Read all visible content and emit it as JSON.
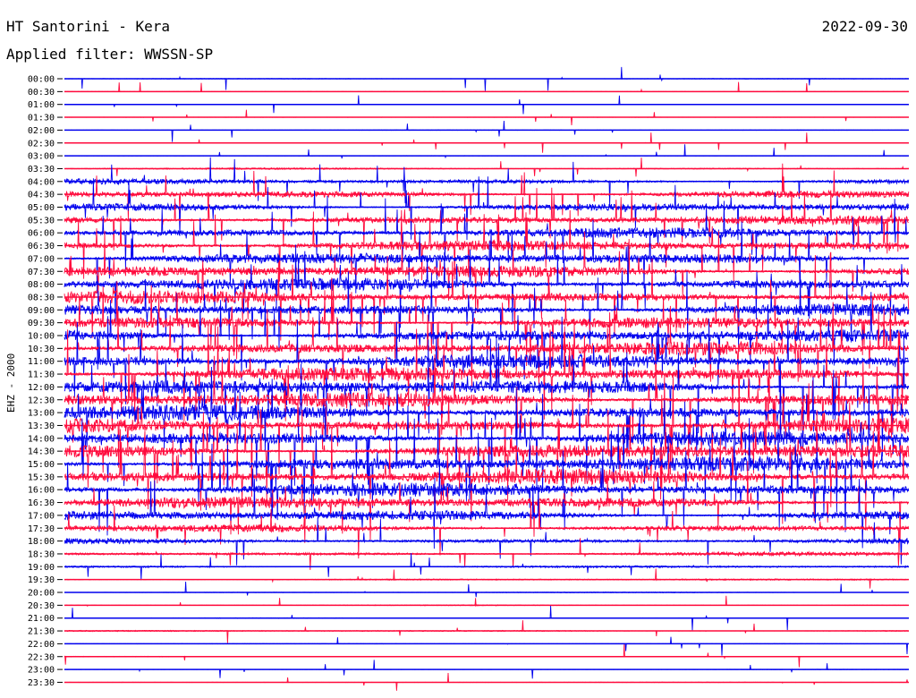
{
  "header": {
    "station": "HT Santorini - Kera",
    "date": "2022-09-30",
    "filter_label": "Applied filter: WWSSN-SP"
  },
  "channel_label": "EHZ - 2000",
  "colors": {
    "trace_a": "#0000ee",
    "trace_b": "#ff0a3c",
    "text": "#000000",
    "background": "#ffffff"
  },
  "chart_data": {
    "type": "line",
    "title": "HT Santorini - Kera",
    "subtitle": "Applied filter: WWSSN-SP",
    "ylabel": "EHZ - 2000",
    "xlabel": "",
    "y_tick_labels": [
      "00:00",
      "00:30",
      "01:00",
      "01:30",
      "02:00",
      "02:30",
      "03:00",
      "03:30",
      "04:00",
      "04:30",
      "05:00",
      "05:30",
      "06:00",
      "06:30",
      "07:00",
      "07:30",
      "08:00",
      "08:30",
      "09:00",
      "09:30",
      "10:00",
      "10:30",
      "11:00",
      "11:30",
      "12:00",
      "12:30",
      "13:00",
      "13:30",
      "14:00",
      "14:30",
      "15:00",
      "15:30",
      "16:00",
      "16:30",
      "17:00",
      "17:30",
      "18:00",
      "18:30",
      "19:00",
      "19:30",
      "20:00",
      "20:30",
      "21:00",
      "21:30",
      "22:00",
      "22:30",
      "23:00",
      "23:30"
    ],
    "row_duration_minutes": 30,
    "series_colors_alternate": [
      "#0000ee",
      "#ff0a3c"
    ],
    "activity_level": [
      0.05,
      0.02,
      0.01,
      0.02,
      0.03,
      0.02,
      0.02,
      0.1,
      0.35,
      0.5,
      0.55,
      0.6,
      0.65,
      0.7,
      0.75,
      0.8,
      0.85,
      0.85,
      0.85,
      0.85,
      0.85,
      0.9,
      0.95,
      0.95,
      1.0,
      1.0,
      1.0,
      1.0,
      1.0,
      1.0,
      1.0,
      1.0,
      0.9,
      0.8,
      0.7,
      0.5,
      0.35,
      0.25,
      0.15,
      0.1,
      0.05,
      0.05,
      0.05,
      0.08,
      0.03,
      0.04,
      0.03,
      0.03
    ],
    "grid": false,
    "legend": "none"
  }
}
